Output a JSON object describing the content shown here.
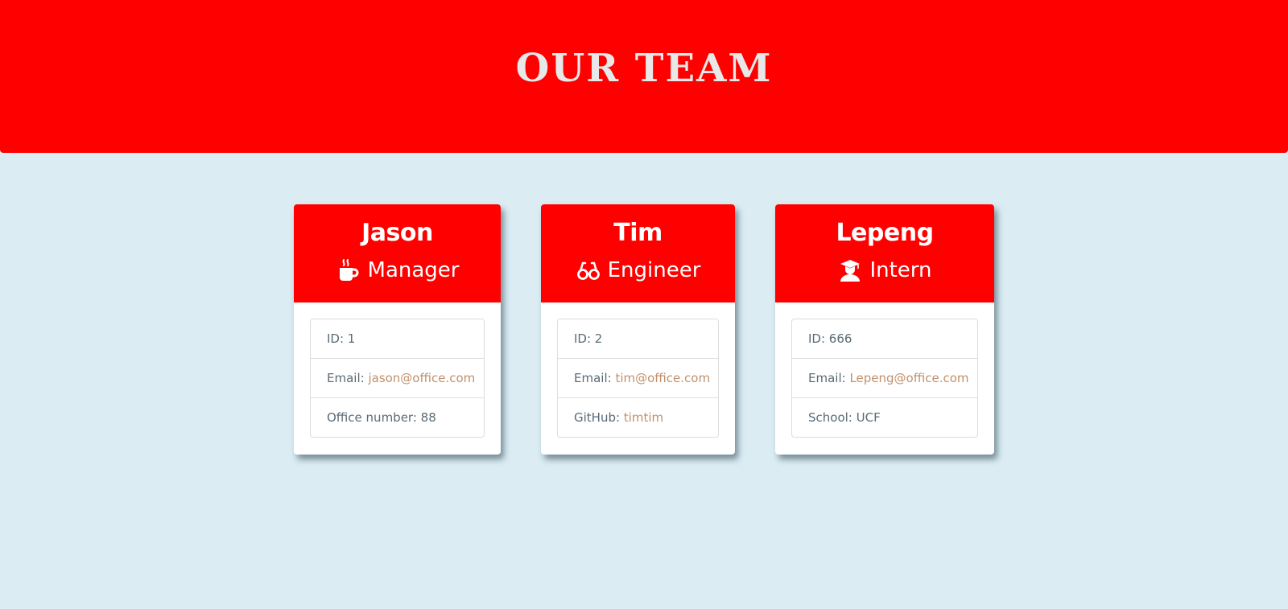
{
  "header": {
    "title": "OUR TEAM",
    "background": "#ff0000"
  },
  "colors": {
    "page_background": "#dbedf3",
    "accent": "#ff0000",
    "link": "#c2906b",
    "text": "#5a6b75"
  },
  "team": [
    {
      "name": "Jason",
      "role": "Manager",
      "role_icon": "coffee-mug-icon",
      "id_label": "ID: 1",
      "email_prefix": "Email: ",
      "email": "jason@office.com",
      "extra_label": "Office number: 88",
      "extra_prefix": "",
      "extra_link": ""
    },
    {
      "name": "Tim",
      "role": "Engineer",
      "role_icon": "glasses-icon",
      "id_label": "ID: 2",
      "email_prefix": "Email: ",
      "email": "tim@office.com",
      "extra_label": "",
      "extra_prefix": "GitHub: ",
      "extra_link": "timtim"
    },
    {
      "name": "Lepeng",
      "role": "Intern",
      "role_icon": "graduate-icon",
      "id_label": "ID: 666",
      "email_prefix": "Email: ",
      "email": "Lepeng@office.com",
      "extra_label": "School: UCF",
      "extra_prefix": "",
      "extra_link": ""
    }
  ]
}
